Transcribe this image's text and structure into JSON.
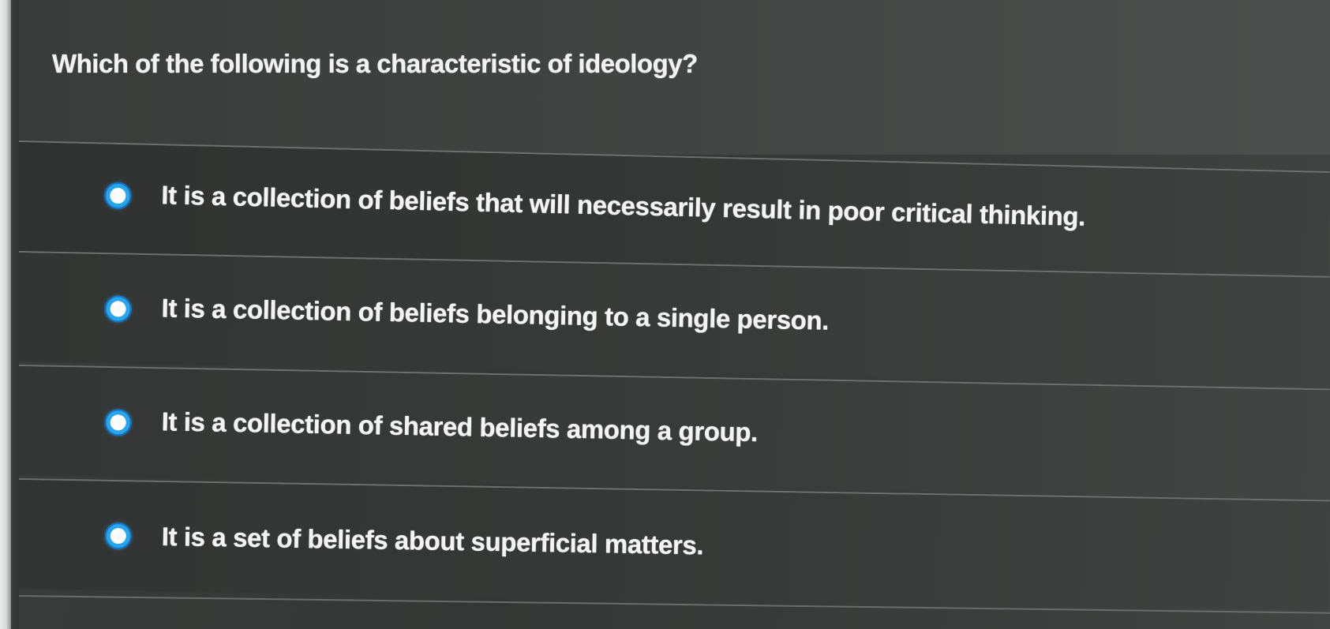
{
  "question": {
    "text": "Which of the following is a characteristic of ideology?"
  },
  "options": [
    {
      "label": "It is a collection of beliefs that will necessarily result in poor critical thinking."
    },
    {
      "label": "It is a collection of beliefs belonging to a single person."
    },
    {
      "label": "It is a collection of shared beliefs among a group."
    },
    {
      "label": "It is a set of beliefs about superficial matters."
    }
  ],
  "colors": {
    "radio_accent": "#27a6ee",
    "background": "#3a3c3b",
    "text": "#f2f2f2"
  }
}
